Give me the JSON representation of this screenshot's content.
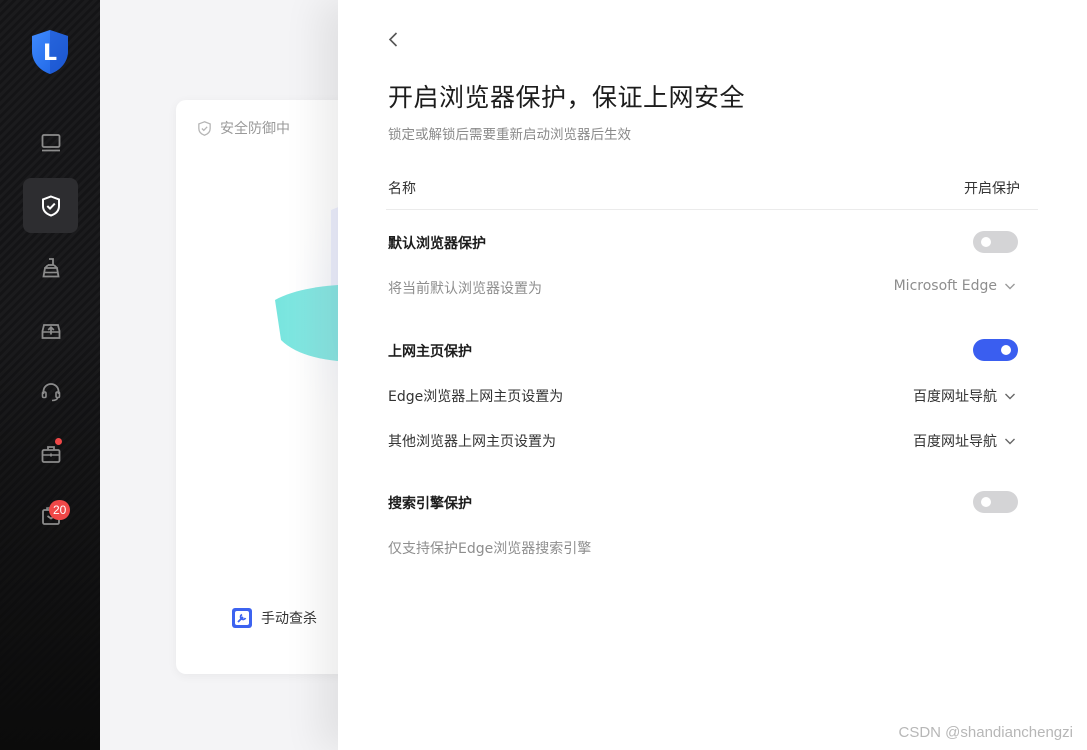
{
  "sidebar": {
    "logo_letter": "L",
    "items": [
      {
        "name": "computer",
        "icon": "monitor-icon",
        "active": false
      },
      {
        "name": "protection",
        "icon": "shield-check-icon",
        "active": true
      },
      {
        "name": "cleanup",
        "icon": "broom-icon",
        "active": false
      },
      {
        "name": "upload",
        "icon": "tray-upload-icon",
        "active": false
      },
      {
        "name": "support",
        "icon": "headset-icon",
        "active": false
      },
      {
        "name": "toolbox",
        "icon": "toolbox-icon",
        "active": false,
        "dot": true
      },
      {
        "name": "messages",
        "icon": "message-box-icon",
        "active": false,
        "badge": "20"
      }
    ]
  },
  "background": {
    "status_text": "安全防御中",
    "manual_scan_label": "手动查杀"
  },
  "panel": {
    "title": "开启浏览器保护，保证上网安全",
    "subtitle": "锁定或解锁后需要重新启动浏览器后生效",
    "col_name": "名称",
    "col_enable": "开启保护",
    "sections": {
      "default_browser": {
        "title": "默认浏览器保护",
        "enabled": false,
        "row_label": "将当前默认浏览器设置为",
        "row_value": "Microsoft Edge"
      },
      "homepage": {
        "title": "上网主页保护",
        "enabled": true,
        "edge_label": "Edge浏览器上网主页设置为",
        "edge_value": "百度网址导航",
        "other_label": "其他浏览器上网主页设置为",
        "other_value": "百度网址导航"
      },
      "search": {
        "title": "搜索引擎保护",
        "enabled": false,
        "note": "仅支持保护Edge浏览器搜索引擎"
      }
    }
  },
  "watermark": "CSDN @shandianchengzi",
  "colors": {
    "accent": "#3a5ef0",
    "toggle_off": "#d4d4d6",
    "badge": "#f04848"
  }
}
